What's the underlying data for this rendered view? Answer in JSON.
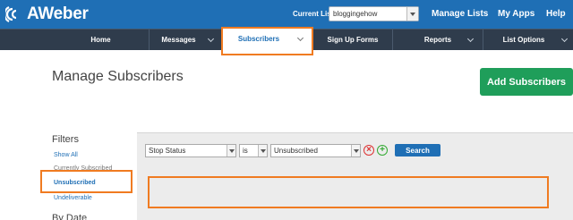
{
  "brand": {
    "name": "AWeber"
  },
  "topbar": {
    "current_list_label": "Current List:",
    "current_list_value": "bloggingehow",
    "links": [
      "Manage Lists",
      "My Apps",
      "Help"
    ]
  },
  "nav": {
    "items": [
      "Home",
      "Messages",
      "Subscribers",
      "Sign Up Forms",
      "Reports",
      "List Options"
    ],
    "active": "Subscribers"
  },
  "page": {
    "title": "Manage Subscribers",
    "add_button": "Add Subscribers"
  },
  "sidebar": {
    "title": "Filters",
    "links": [
      "Show All",
      "Currently Subscribed",
      "Unsubscribed",
      "Undeliverable"
    ],
    "active": "Unsubscribed",
    "next_section": "By Date"
  },
  "search": {
    "field": "Stop Status",
    "operator": "is",
    "value": "Unsubscribed",
    "button": "Search"
  },
  "colors": {
    "topbar": "#1f6fb5",
    "navbar": "#2f3c4c",
    "highlight": "#f07b21",
    "add_button": "#1f9e5a"
  }
}
